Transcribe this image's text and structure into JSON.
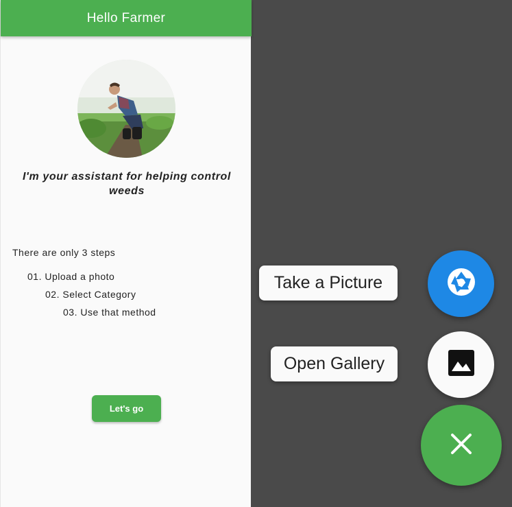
{
  "appbar": {
    "title": "Hello Farmer"
  },
  "main": {
    "tagline": "I'm your assistant for helping control weeds",
    "steps_intro": "There are only 3 steps",
    "steps": [
      "01. Upload a photo",
      "02. Select Category",
      "03. Use that method"
    ],
    "go_button": "Let's go"
  },
  "speed_dial": {
    "take_picture_label": "Take a Picture",
    "open_gallery_label": "Open Gallery",
    "icons": {
      "camera": "camera-shutter-icon",
      "gallery": "image-icon",
      "close": "close-icon"
    }
  },
  "colors": {
    "primary": "#4caf50",
    "camera_fab": "#1e88e5",
    "overlay": "#4a4a4a"
  }
}
